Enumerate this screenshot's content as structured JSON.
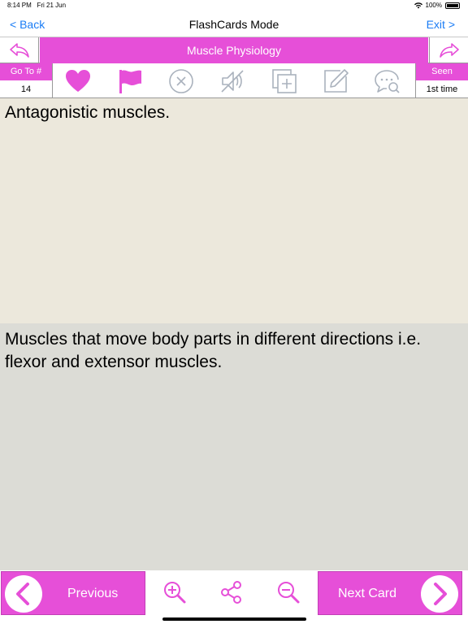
{
  "status_bar": {
    "time": "8:14 PM",
    "date": "Fri 21 Jun",
    "battery": "100%"
  },
  "nav": {
    "back_label": "< Back",
    "title": "FlashCards Mode",
    "exit_label": "Exit >"
  },
  "subject": {
    "title": "Muscle Physiology"
  },
  "toolbar": {
    "goto_label": "Go To #",
    "goto_value": "14",
    "seen_label": "Seen",
    "seen_value": "1st time",
    "icons": [
      "heart-icon",
      "flag-icon",
      "close-circle-icon",
      "mute-icon",
      "copy-add-icon",
      "edit-icon",
      "comment-search-icon"
    ]
  },
  "card": {
    "question": "Antagonistic muscles.",
    "answer": "Muscles that move body parts in different directions i.e. flexor and extensor muscles."
  },
  "bottom": {
    "previous_label": "Previous",
    "next_label": "Next Card",
    "icons": [
      "zoom-in-icon",
      "share-icon",
      "zoom-out-icon"
    ]
  },
  "colors": {
    "accent": "#e64fd8",
    "link": "#1a7cf5",
    "question_bg": "#ece8dc",
    "answer_bg": "#dcdcd6",
    "disabled_icon": "#aab2bd"
  }
}
